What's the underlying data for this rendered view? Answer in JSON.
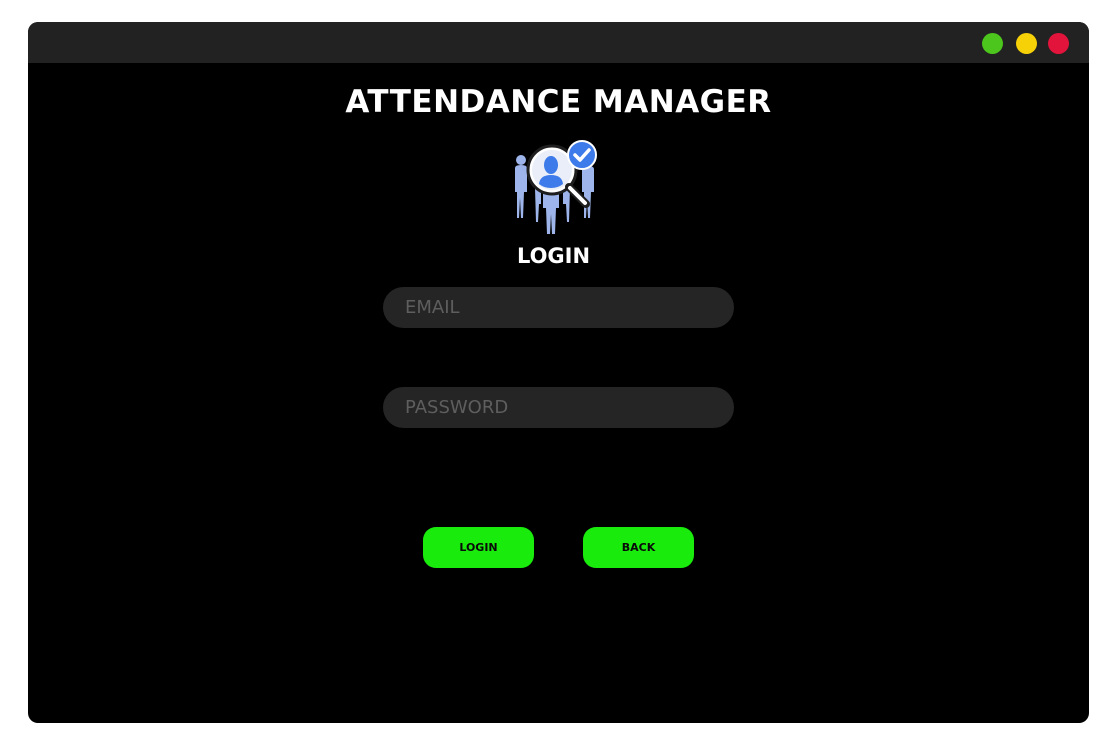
{
  "window": {
    "controls": [
      {
        "name": "green",
        "color": "#4cc51c"
      },
      {
        "name": "yellow",
        "color": "#f7d108"
      },
      {
        "name": "red",
        "color": "#e3143c"
      }
    ]
  },
  "app": {
    "title": "ATTENDANCE MANAGER",
    "logo_icon": "attendance-people-magnifier-icon"
  },
  "login": {
    "heading": "LOGIN",
    "email_placeholder": "EMAIL",
    "email_value": "",
    "password_placeholder": "PASSWORD",
    "password_value": "",
    "login_button": "LOGIN",
    "back_button": "BACK"
  },
  "colors": {
    "background": "#000000",
    "titlebar": "#222222",
    "field_background": "#252525",
    "accent": "#19ec0d"
  }
}
